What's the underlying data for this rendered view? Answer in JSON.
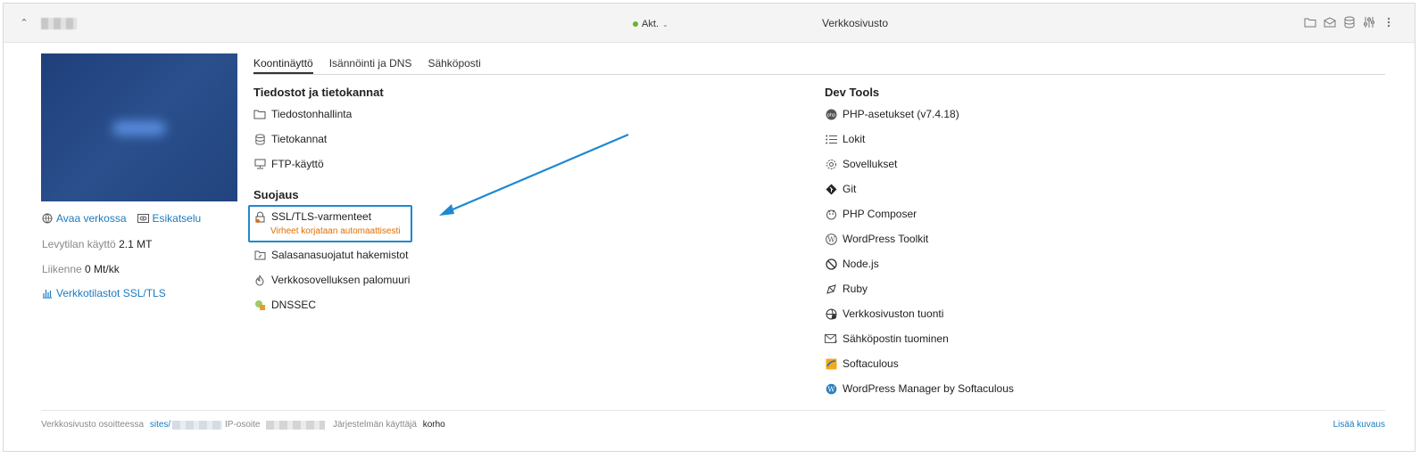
{
  "header": {
    "status_label": "Akt.",
    "status_color": "#6ab22d",
    "site_type": "Verkkosivusto",
    "icons": [
      "folder-icon",
      "mail-icon",
      "database-icon",
      "settings-sliders-icon",
      "more-vertical-icon"
    ]
  },
  "left": {
    "open_online": "Avaa verkossa",
    "preview": "Esikatselu",
    "disk_label": "Levytilan käyttö",
    "disk_value": "2.1 MT",
    "traffic_label": "Liikenne",
    "traffic_value": "0 Mt/kk",
    "stats_link": "Verkkotilastot SSL/TLS"
  },
  "tabs": [
    "Koontinäyttö",
    "Isännöinti ja DNS",
    "Sähköposti"
  ],
  "files_section": {
    "title": "Tiedostot ja tietokannat",
    "items": [
      "Tiedostonhallinta",
      "Tietokannat",
      "FTP-käyttö"
    ]
  },
  "security_section": {
    "title": "Suojaus",
    "ssl_label": "SSL/TLS-varmenteet",
    "ssl_warning": "Virheet korjataan automaattisesti",
    "items": [
      "Salasanasuojatut hakemistot",
      "Verkkosovelluksen palomuuri",
      "DNSSEC"
    ]
  },
  "dev_tools": {
    "title": "Dev Tools",
    "items": [
      "PHP-asetukset (v7.4.18)",
      "Lokit",
      "Sovellukset",
      "Git",
      "PHP Composer",
      "WordPress Toolkit",
      "Node.js",
      "Ruby",
      "Verkkosivuston tuonti",
      "Sähköpostin tuominen",
      "Softaculous",
      "WordPress Manager by Softaculous"
    ]
  },
  "footer": {
    "site_at_label": "Verkkosivusto osoitteessa",
    "site_path": "sites/",
    "ip_label": "IP-osoite",
    "sys_user_label": "Järjestelmän käyttäjä",
    "sys_user_value": "korho",
    "add_description": "Lisää kuvaus"
  },
  "colors": {
    "link": "#1a7bc1",
    "warning": "#e06e00",
    "highlight": "#1e88d0"
  }
}
